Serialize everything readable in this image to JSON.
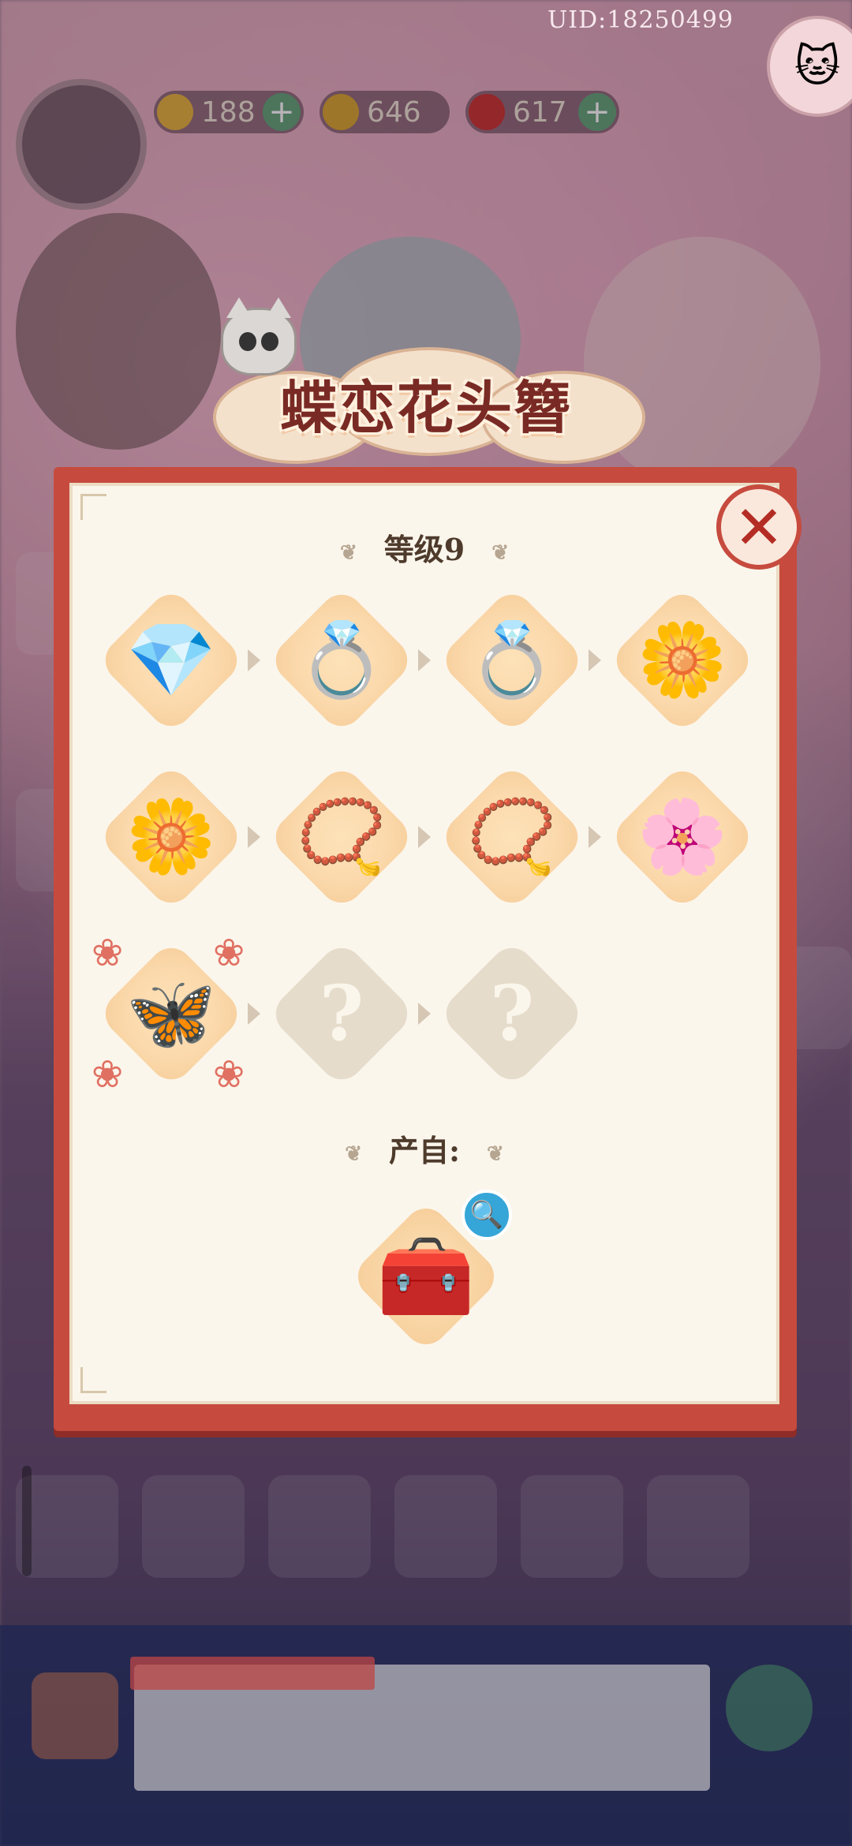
{
  "uid": "UID:18250499",
  "hud": {
    "energy": "188",
    "coins": "646",
    "gems": "617"
  },
  "title": "蝶恋花头簪",
  "level_label": "等级9",
  "source_label": "产自:",
  "close_icon": "close-icon",
  "chain": [
    {
      "art": "💎",
      "name": "blue-gem-icon",
      "locked": false
    },
    {
      "art": "💍",
      "name": "gold-ring-icon",
      "locked": false
    },
    {
      "art": "💍",
      "name": "flower-ring-icon",
      "locked": false
    },
    {
      "art": "🌼",
      "name": "gold-flowers-icon",
      "locked": false
    },
    {
      "art": "🌼",
      "name": "gold-earrings-icon",
      "locked": false
    },
    {
      "art": "📿",
      "name": "beaded-bracelet-icon",
      "locked": false
    },
    {
      "art": "📿",
      "name": "double-bracelet-icon",
      "locked": false
    },
    {
      "art": "🌸",
      "name": "flower-hairpin-icon",
      "locked": false
    },
    {
      "art": "🦋",
      "name": "butterfly-hairpin-icon",
      "locked": false,
      "current": true
    },
    {
      "art": "?",
      "name": "locked-item-icon",
      "locked": true
    },
    {
      "art": "?",
      "name": "locked-item-icon",
      "locked": true
    }
  ],
  "source": {
    "art": "🧰",
    "name": "treasure-chest-icon"
  },
  "colors": {
    "panel_border": "#c64b3e",
    "panel_bg": "#fbf6ec",
    "title_text": "#7a2a24",
    "tile_bg": "#fbd9ac"
  }
}
